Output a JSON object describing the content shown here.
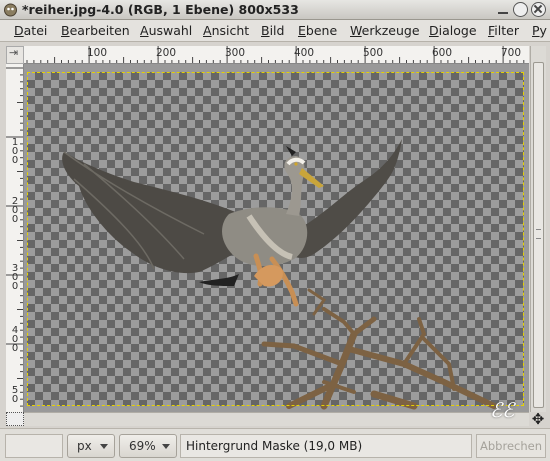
{
  "window": {
    "title": "*reiher.jpg-4.0 (RGB, 1 Ebene) 800x533"
  },
  "menu": [
    "Datei",
    "Bearbeiten",
    "Auswahl",
    "Ansicht",
    "Bild",
    "Ebene",
    "Werkzeuge",
    "Dialoge",
    "Filter",
    "Py"
  ],
  "ruler": {
    "h_labels": [
      "100",
      "200",
      "300",
      "400",
      "500",
      "600",
      "700"
    ],
    "v_labels": [
      "1 0 0",
      "2 0 0",
      "3 0 0",
      "4 0 0",
      "5 0"
    ]
  },
  "status": {
    "unit": "px",
    "zoom": "69%",
    "message": "Hintergrund Maske (19,0 MB)",
    "cancel_label": "Abbrechen"
  },
  "watermark": "ℰℰ",
  "nav_icon": "✥"
}
